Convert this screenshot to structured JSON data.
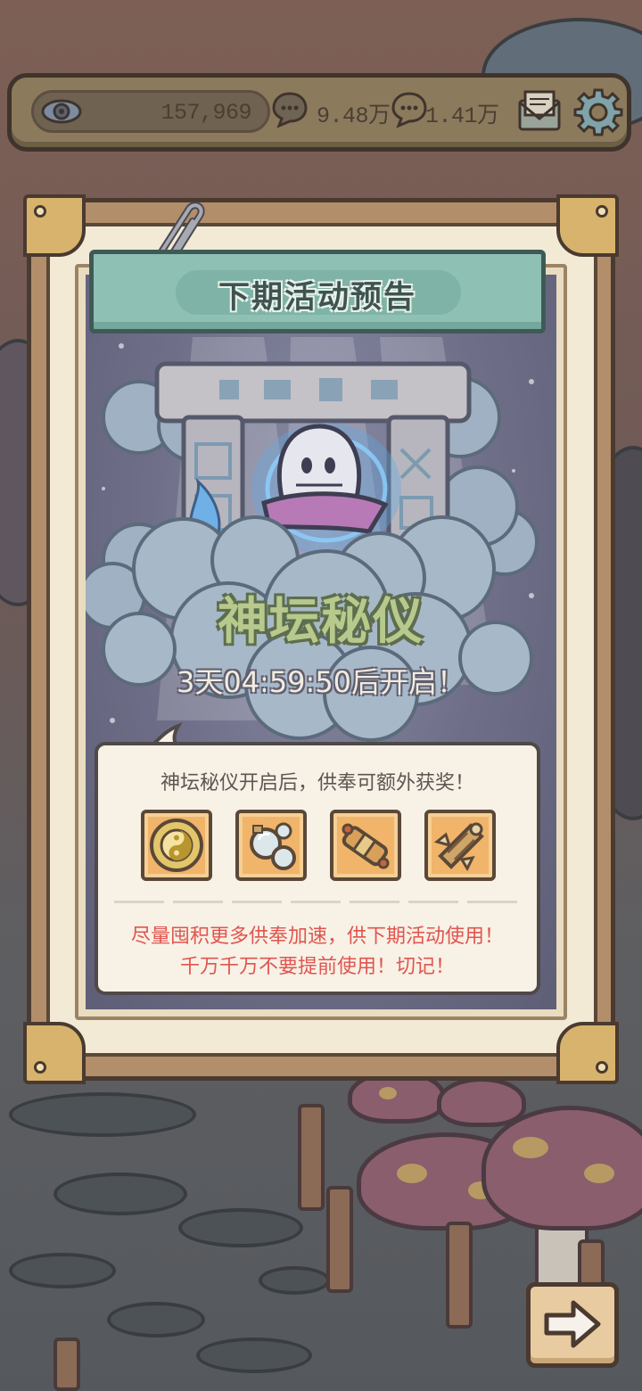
{
  "resources": {
    "eye_value": "157,969",
    "chat1_value": "9.48万",
    "chat2_value": "1.41万"
  },
  "panel": {
    "banner_title": "下期活动预告",
    "event_title": "神坛秘仪",
    "countdown": "3天04:59:50后开启！"
  },
  "info": {
    "line1": "神坛秘仪开启后，供奉可额外获奖！",
    "warning_line1": "尽量囤积更多供奉加速，供下期活动使用！",
    "warning_line2": "千万千万不要提前使用！切记！"
  },
  "rewards": [
    {
      "icon": "yin-yang-coin-icon"
    },
    {
      "icon": "glass-orbs-icon"
    },
    {
      "icon": "scroll-capsule-icon"
    },
    {
      "icon": "ornate-cannon-icon"
    }
  ],
  "colors": {
    "banner": "#8ec0b4",
    "event_title": "#b8c98d",
    "warning_text": "#e0554f",
    "reward_tile": "#f0b46a"
  }
}
